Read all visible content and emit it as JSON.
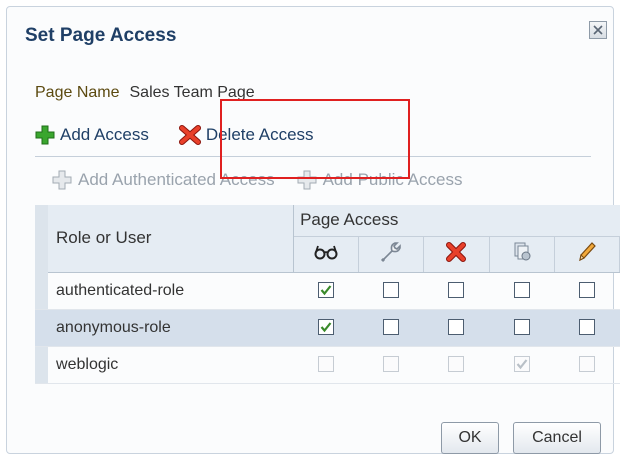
{
  "dialog": {
    "title": "Set Page Access",
    "page_name_label": "Page Name",
    "page_name_value": "Sales Team Page"
  },
  "toolbar": {
    "add_access": "Add Access",
    "delete_access": "Delete Access",
    "add_authenticated_access": "Add Authenticated Access",
    "add_public_access": "Add Public Access"
  },
  "table": {
    "col_role": "Role or User",
    "col_group": "Page Access",
    "permission_icons": [
      "view-icon",
      "customize-icon",
      "delete-icon",
      "grant-icon",
      "edit-icon"
    ],
    "rows": [
      {
        "role": "authenticated-role",
        "checks": [
          true,
          false,
          false,
          false,
          false
        ],
        "enabled": true,
        "selected": false
      },
      {
        "role": "anonymous-role",
        "checks": [
          true,
          false,
          false,
          false,
          false
        ],
        "enabled": true,
        "selected": true
      },
      {
        "role": "weblogic",
        "checks": [
          false,
          false,
          false,
          true,
          false
        ],
        "enabled": false,
        "selected": false
      }
    ]
  },
  "buttons": {
    "ok": "OK",
    "cancel": "Cancel"
  },
  "colors": {
    "title": "#1f3f66",
    "selected_row": "#d5dfeb",
    "highlight_box": "#e02020",
    "add_green": "#3aa62e",
    "delete_red": "#d42a1c"
  }
}
